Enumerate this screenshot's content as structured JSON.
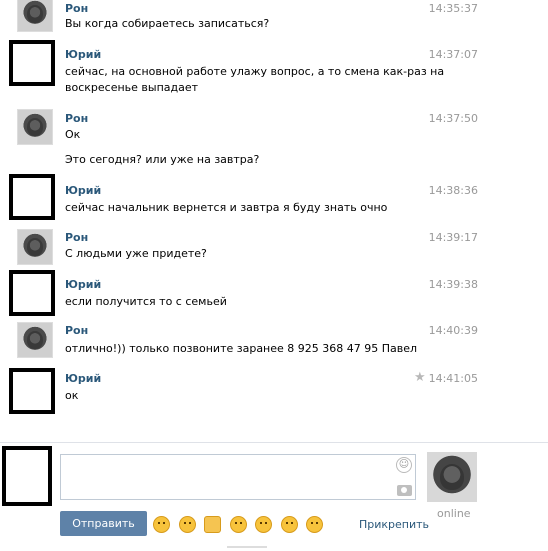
{
  "messages": [
    {
      "author": "Рон",
      "time": "14:35:37",
      "lines": [
        "Вы когда собираетесь записаться?"
      ]
    },
    {
      "author": "Юрий",
      "time": "14:37:07",
      "lines": [
        "сейчас, на основной работе улажу вопрос, а то смена как-раз на",
        "воскресенье выпадает"
      ]
    },
    {
      "author": "Рон",
      "time": "14:37:50",
      "lines": [
        "Ок",
        "",
        "Это сегодня? или уже на завтра?"
      ]
    },
    {
      "author": "Юрий",
      "time": "14:38:36",
      "lines": [
        "сейчас начальник вернется и завтра я буду знать очно"
      ]
    },
    {
      "author": "Рон",
      "time": "14:39:17",
      "lines": [
        "С людьми уже придете?"
      ]
    },
    {
      "author": "Юрий",
      "time": "14:39:38",
      "lines": [
        "если получится то с семьей"
      ]
    },
    {
      "author": "Рон",
      "time": "14:40:39",
      "lines": [
        "отлично!)) только позвоните заранее 8 925 368 47 95 Павел"
      ]
    },
    {
      "author": "Юрий",
      "time": "14:41:05",
      "lines": [
        "ок"
      ]
    }
  ],
  "composer": {
    "send_label": "Отправить",
    "attach_label": "Прикрепить",
    "status": "online",
    "icons": [
      "smile-icon",
      "camera-icon"
    ],
    "emoji": [
      "laughing",
      "kissing",
      "thumbs-up",
      "winking",
      "tongue",
      "kissing-heart",
      "smiling"
    ]
  }
}
